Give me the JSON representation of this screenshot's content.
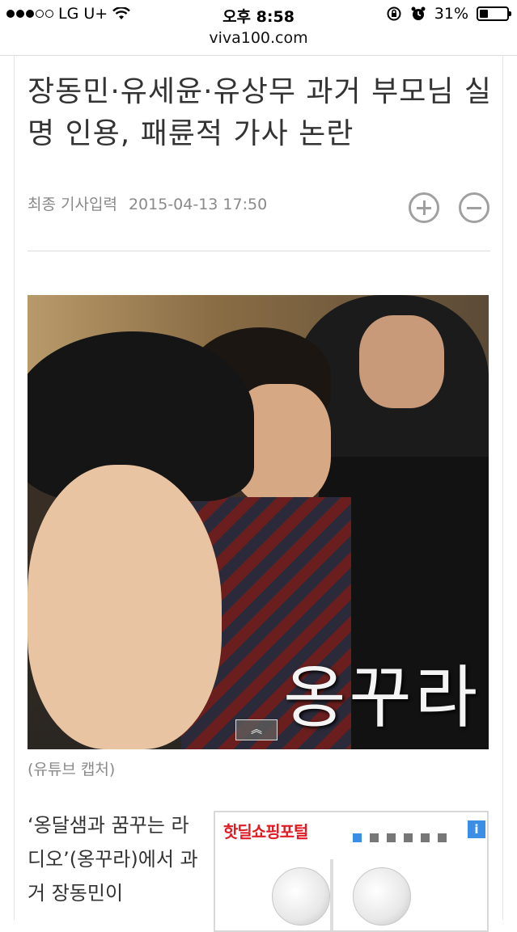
{
  "status_bar": {
    "carrier": "LG U+",
    "time": "오후 8:58",
    "battery": "31%",
    "battery_level": 0.31,
    "icons": [
      "signal-dots-icon",
      "wifi-icon",
      "rotation-lock-icon",
      "alarm-icon",
      "battery-icon"
    ]
  },
  "browser": {
    "url": "viva100.com"
  },
  "article": {
    "title": "장동민·유세윤·유상무 과거 부모님 실명 인용, 패륜적 가사 논란",
    "date_label": "최종 기사입력",
    "date": "2015-04-13 17:50",
    "photo_overlay_text": "옹꾸라",
    "photo_caption": "(유튜브 캡처)",
    "body": "‘옹달샘과 꿈꾸는 라디오’(옹꾸라)에서 과거 장동민이"
  },
  "ad": {
    "title": "핫딜쇼핑포털",
    "info_label": "i",
    "pager_count": 6,
    "pager_active": 0
  },
  "colors": {
    "title": "#333333",
    "meta": "#8a8a8a",
    "ad_title": "#e01b24",
    "ad_accent": "#3a8ee6"
  }
}
